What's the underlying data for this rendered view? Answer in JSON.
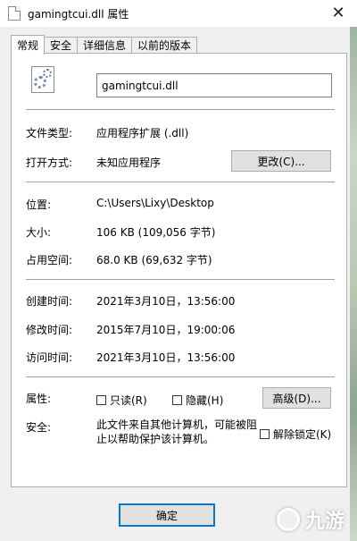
{
  "window": {
    "title": "gamingtcui.dll 属性",
    "close_label": "✕"
  },
  "tabs": [
    {
      "label": "常规",
      "active": true
    },
    {
      "label": "安全",
      "active": false
    },
    {
      "label": "详细信息",
      "active": false
    },
    {
      "label": "以前的版本",
      "active": false
    }
  ],
  "general": {
    "file_name": "gamingtcui.dll",
    "file_type_label": "文件类型:",
    "file_type_value": "应用程序扩展 (.dll)",
    "opens_with_label": "打开方式:",
    "opens_with_value": "未知应用程序",
    "change_button": "更改(C)...",
    "location_label": "位置:",
    "location_value": "C:\\Users\\Lixy\\Desktop",
    "size_label": "大小:",
    "size_value": "106 KB (109,056 字节)",
    "size_on_disk_label": "占用空间:",
    "size_on_disk_value": "68.0 KB (69,632 字节)",
    "created_label": "创建时间:",
    "created_value": "2021年3月10日，13:56:00",
    "modified_label": "修改时间:",
    "modified_value": "2015年7月10日，19:00:06",
    "accessed_label": "访问时间:",
    "accessed_value": "2021年3月10日，13:56:00",
    "attributes_label": "属性:",
    "readonly_label": "只读(R)",
    "hidden_label": "隐藏(H)",
    "advanced_button": "高级(D)...",
    "security_label": "安全:",
    "security_text": "此文件来自其他计算机，可能被阻止以帮助保护该计算机。",
    "unblock_label": "解除锁定(K)"
  },
  "footer": {
    "ok_button": "确定"
  },
  "watermark": {
    "text": "九游"
  }
}
